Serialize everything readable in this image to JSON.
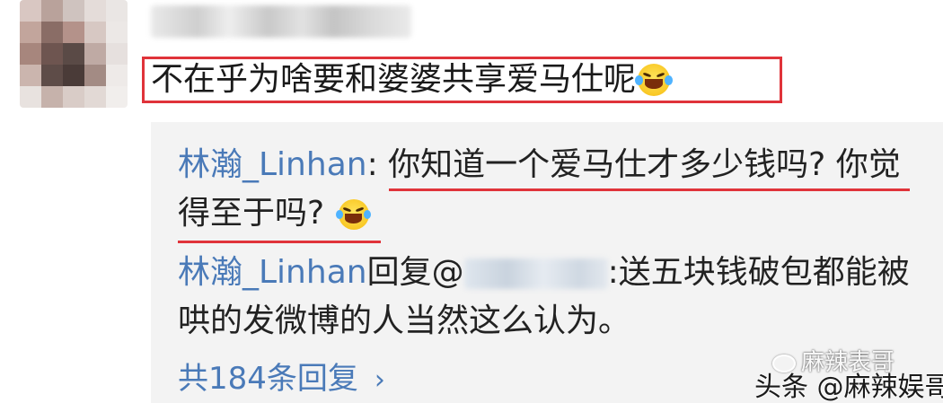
{
  "comment": {
    "text": "不在乎为啥要和婆婆共享爱马仕呢",
    "emoji": "laughing-crying-emoji"
  },
  "replies": [
    {
      "author": "林瀚_Linhan",
      "separator": ": ",
      "line1": "你知道一个爱马仕才多少钱吗? 你觉",
      "line2": "得至于吗?",
      "emoji": "laughing-crying-emoji"
    },
    {
      "author": "林瀚_Linhan",
      "prefix": "回复@",
      "line1_after": ":送五块钱破包都能被",
      "line2": "哄的发微博的人当然这么认为。"
    }
  ],
  "more_replies": {
    "label": "共184条回复",
    "chevron": "›"
  },
  "watermark": {
    "top": "麻辣表哥",
    "bottom": "头条 @麻辣娱哥"
  },
  "colors": {
    "highlight": "#e0333a",
    "link": "#4a7ab8",
    "panel": "#f3f3f3"
  }
}
